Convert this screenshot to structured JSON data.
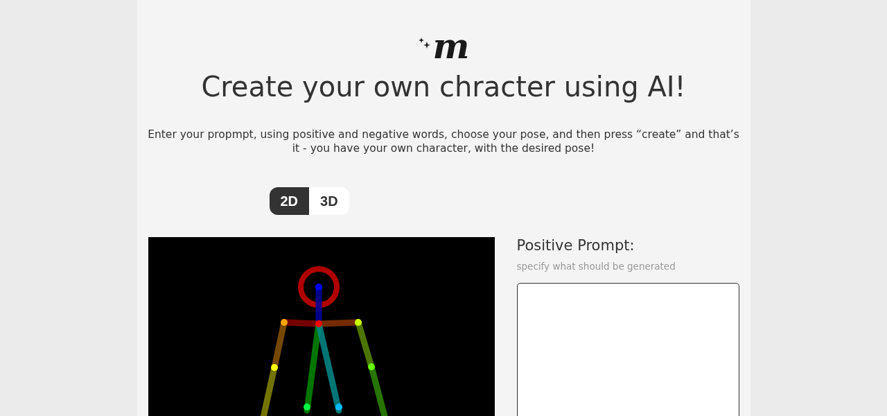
{
  "logo": {
    "text": "m"
  },
  "title": "Create your own chracter using AI!",
  "description": "Enter your propmpt, using positive and negative words, choose your pose, and then press “create” and that’s it - you have your own character, with the desired pose!",
  "mode_toggle": [
    {
      "label": "2D",
      "selected": true
    },
    {
      "label": "3D",
      "selected": false
    }
  ],
  "positive_prompt": {
    "label": "Positive Prompt:",
    "hint": "specify what should be generated"
  }
}
